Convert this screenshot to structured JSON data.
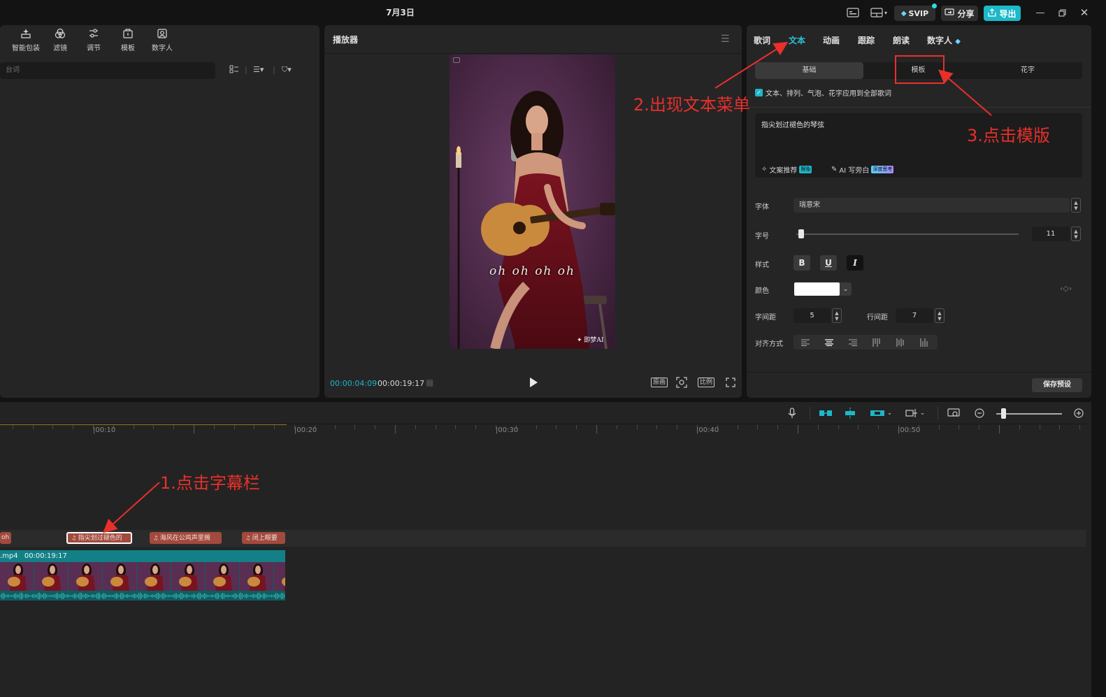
{
  "window": {
    "title": "7月3日",
    "svip_label": "SVIP",
    "share_label": "分享",
    "export_label": "导出"
  },
  "media_panel": {
    "tools": [
      {
        "label": "智能包装",
        "icon": "sparkle-box-icon"
      },
      {
        "label": "滤镜",
        "icon": "filter-icon"
      },
      {
        "label": "调节",
        "icon": "sliders-icon"
      },
      {
        "label": "模板",
        "icon": "template-icon"
      },
      {
        "label": "数字人",
        "icon": "avatar-icon"
      }
    ],
    "search_placeholder": "台词"
  },
  "player": {
    "title": "播放器",
    "current_time": "00:00:04:09",
    "total_time": "00:00:19:17",
    "caption": "oh oh oh oh",
    "watermark": "即梦AI",
    "original_label": "原画",
    "ratio_label": "比例"
  },
  "text_panel": {
    "tabs": [
      "歌词",
      "文本",
      "动画",
      "跟踪",
      "朗读",
      "数字人"
    ],
    "active_tab": "文本",
    "subtabs": [
      "基础",
      "模板",
      "花字"
    ],
    "apply_all_label": "文本、排列、气泡、花字应用到全部歌词",
    "text_value": "指尖划过褪色的琴弦",
    "ai_copy_label": "文案推荐",
    "ai_copy_badge": "限免",
    "ai_write_label": "AI 写旁白",
    "ai_write_badge": "深度思考",
    "font_label": "字体",
    "font_value": "瑞意宋",
    "size_label": "字号",
    "size_value": "11",
    "style_label": "样式",
    "color_label": "颜色",
    "letter_spacing_label": "字间距",
    "letter_spacing_value": "5",
    "line_spacing_label": "行间距",
    "line_spacing_value": "7",
    "align_label": "对齐方式",
    "save_preset_label": "保存预设",
    "accent": "#2bc3d6"
  },
  "timeline": {
    "ruler_labels": [
      "|00:10",
      "|00:20",
      "|00:30",
      "|00:40",
      "|00:50"
    ],
    "subtitle_clips": [
      "oh",
      "指尖划过褪色的",
      "海风在公鸡声里搁",
      "闭上眼要"
    ],
    "video_clip_name": ".mp4",
    "video_clip_duration": "00:00:19:17"
  },
  "annotations": {
    "step1": "1.点击字幕栏",
    "step2": "2.出现文本菜单",
    "step3": "3.点击模版",
    "color": "#e8302b"
  }
}
